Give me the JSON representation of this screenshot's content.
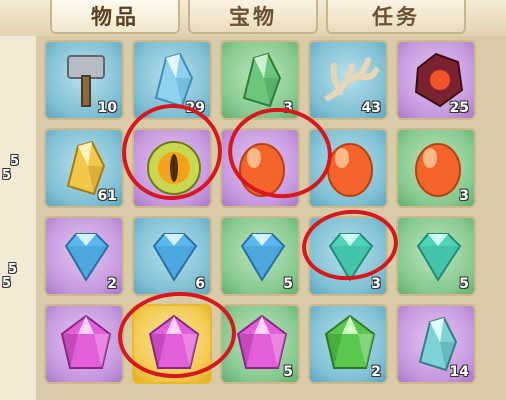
{
  "tabs": [
    {
      "label": "物品",
      "active": true
    },
    {
      "label": "宝物",
      "active": false
    },
    {
      "label": "任务",
      "active": false
    }
  ],
  "side_counts": [
    "5",
    "5",
    "5",
    "5"
  ],
  "inventory": {
    "rows": [
      [
        {
          "item": "hammer-icon",
          "rarity": "blue",
          "count": "10"
        },
        {
          "item": "blue-crystal-icon",
          "rarity": "blue",
          "count": "29"
        },
        {
          "item": "green-crystal-icon",
          "rarity": "green",
          "count": "3"
        },
        {
          "item": "antler-icon",
          "rarity": "blue",
          "count": "43"
        },
        {
          "item": "red-ore-icon",
          "rarity": "purple",
          "count": "25"
        }
      ],
      [
        {
          "item": "gold-ore-icon",
          "rarity": "blue",
          "count": "61"
        },
        {
          "item": "golden-orb-icon",
          "rarity": "purple",
          "count": ""
        },
        {
          "item": "orange-gem-icon",
          "rarity": "purple",
          "count": ""
        },
        {
          "item": "orange-gem-icon",
          "rarity": "blue",
          "count": ""
        },
        {
          "item": "orange-gem-icon",
          "rarity": "green",
          "count": "3"
        }
      ],
      [
        {
          "item": "blue-diamond-icon",
          "rarity": "purple",
          "count": "2"
        },
        {
          "item": "blue-diamond-icon",
          "rarity": "blue",
          "count": "6"
        },
        {
          "item": "blue-diamond-icon",
          "rarity": "green",
          "count": "5"
        },
        {
          "item": "teal-diamond-icon",
          "rarity": "blue",
          "count": "3"
        },
        {
          "item": "teal-diamond-icon",
          "rarity": "green",
          "count": "5"
        }
      ],
      [
        {
          "item": "pink-crystal-icon",
          "rarity": "purple",
          "count": ""
        },
        {
          "item": "pink-crystal-icon",
          "rarity": "gold",
          "count": ""
        },
        {
          "item": "pink-crystal-icon",
          "rarity": "green",
          "count": "5"
        },
        {
          "item": "green-gem-icon",
          "rarity": "blue",
          "count": "2"
        },
        {
          "item": "jade-shard-icon",
          "rarity": "purple",
          "count": "14"
        }
      ]
    ]
  },
  "colors": {
    "highlight_ring": "#d8171c",
    "tab_text": "#6b5131"
  }
}
